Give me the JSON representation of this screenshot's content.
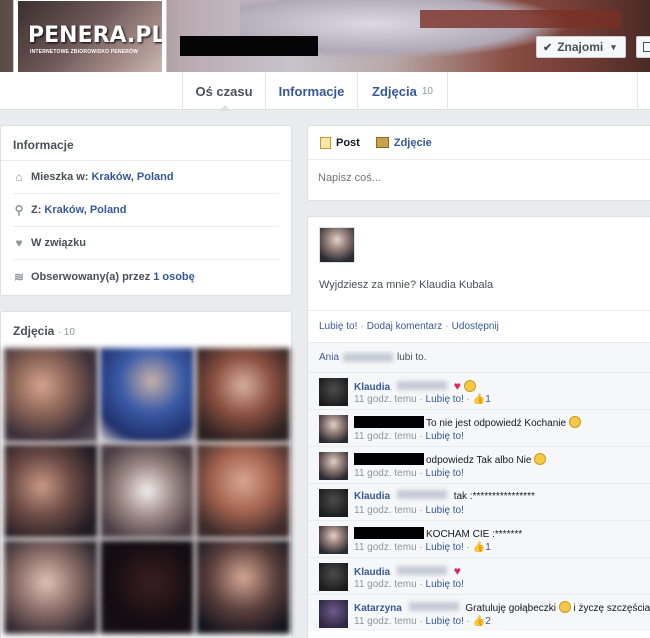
{
  "header": {
    "logo_text": "PENERA.PL",
    "logo_tagline": "INTERNETOWE ZBIOROWISKO PENERÓW",
    "friends_button": "Znajomi",
    "friends_check": "✔",
    "friends_caret": "▾"
  },
  "tabs": [
    {
      "label": "Oś czasu"
    },
    {
      "label": "Informacje"
    },
    {
      "label": "Zdjęcia",
      "count": "10"
    }
  ],
  "info": {
    "title": "Informacje",
    "lives_prefix": "Mieszka w:",
    "lives_value": "Kraków, Poland",
    "from_prefix": "Z:",
    "from_value": "Kraków, Poland",
    "relationship": "W związku",
    "followers_prefix": "Obserwowany(a) przez",
    "followers_value": "1 osobę"
  },
  "photos": {
    "title": "Zdjęcia",
    "count": "· 10"
  },
  "composer": {
    "tab_post": "Post",
    "tab_photo": "Zdjęcie",
    "placeholder": "Napisz coś..."
  },
  "post": {
    "text": "Wyjdziesz za mnie? Klaudia Kubala",
    "action_like": "Lubię to!",
    "action_comment": "Dodaj komentarz",
    "action_share": "Udostępnij",
    "sep": "·",
    "likes_prefix": "Ania",
    "likes_suffix": "lubi to."
  },
  "comments": [
    {
      "author": "Klaudia",
      "text": "",
      "time": "11 godz. temu",
      "like": "Lubię to!",
      "likes": "1",
      "emoji": "heart+smile"
    },
    {
      "author": "",
      "text": "To nie jest odpowiedź Kochanie",
      "time": "11 godz. temu",
      "like": "Lubię to!",
      "likes": "",
      "emoji": "smile"
    },
    {
      "author": "",
      "text": "odpowiedz Tak albo Nie",
      "time": "11 godz. temu",
      "like": "Lubię to!",
      "likes": "",
      "emoji": "smile"
    },
    {
      "author": "Klaudia",
      "text": "tak :****************",
      "time": "11 godz. temu",
      "like": "Lubię to!",
      "likes": "",
      "emoji": ""
    },
    {
      "author": "",
      "text": "KOCHAM CIE :*******",
      "time": "11 godz. temu",
      "like": "Lubię to!",
      "likes": "1",
      "emoji": ""
    },
    {
      "author": "Klaudia",
      "text": "",
      "time": "11 godz. temu",
      "like": "Lubię to!",
      "likes": "",
      "emoji": "heart"
    },
    {
      "author": "Katarzyna",
      "text": "Gratuluję gołąbeczki",
      "text2": "i życzę szczęścia!",
      "time": "11 godz. temu",
      "like": "Lubię to!",
      "likes": "2",
      "emoji": "smile"
    }
  ],
  "colors": {
    "link": "#365899",
    "background": "#e9ebee"
  }
}
